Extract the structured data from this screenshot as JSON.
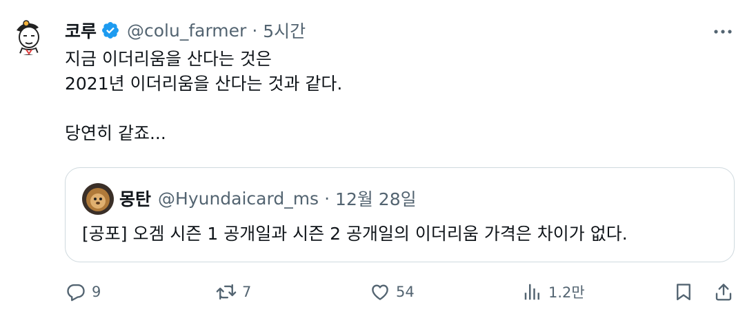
{
  "author": {
    "name": "코루",
    "handle": "@colu_farmer",
    "separator": "·",
    "time": "5시간",
    "avatar_icon": "cartoon-farmer-avatar",
    "verified_icon": "verified-badge-icon"
  },
  "tweet": {
    "lines": [
      "지금 이더리움을 산다는 것은",
      "2021년 이더리움을 산다는 것과 같다.",
      "",
      "당연히 같죠..."
    ]
  },
  "quoted": {
    "name": "몽탄",
    "handle": "@Hyundaicard_ms",
    "separator": "·",
    "time": "12월 28일",
    "avatar_icon": "lion-avatar",
    "text": "[공포] 오겜 시즌 1 공개일과 시즌 2 공개일의 이더리움 가격은 차이가 없다."
  },
  "actions": {
    "reply_count": "9",
    "retweet_count": "7",
    "like_count": "54",
    "views_count": "1.2만"
  },
  "colors": {
    "text": "#0f1419",
    "secondary": "#536471",
    "border": "#cfd9de",
    "verified": "#1d9bf0"
  }
}
